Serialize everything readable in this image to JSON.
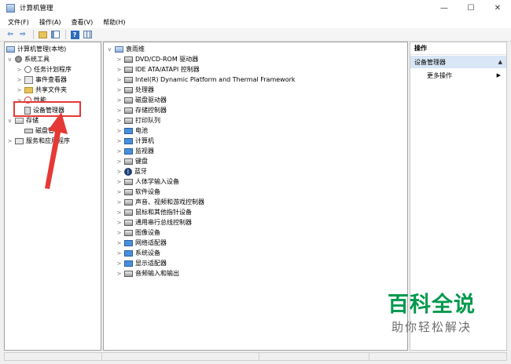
{
  "window": {
    "title": "计算机管理",
    "minimize_glyph": "—",
    "maximize_glyph": "☐",
    "close_glyph": "✕"
  },
  "menubar": [
    "文件(F)",
    "操作(A)",
    "查看(V)",
    "帮助(H)"
  ],
  "toolbar": {
    "back_glyph": "⇦",
    "forward_glyph": "⇨",
    "help_glyph": "?"
  },
  "left_tree": {
    "root": "计算机管理(本地)",
    "system_tools": "系统工具",
    "task_scheduler": "任务计划程序",
    "event_viewer": "事件查看器",
    "shared_folders": "共享文件夹",
    "performance": "性能",
    "device_manager": "设备管理器",
    "storage": "存储",
    "disk_management": "磁盘管理",
    "services_apps": "服务和应用程序"
  },
  "device_tree": {
    "root": "袁雨维",
    "categories": [
      {
        "label": "DVD/CD-ROM 驱动器",
        "icon": "dvd-icon"
      },
      {
        "label": "IDE ATA/ATAPI 控制器",
        "icon": "ide-controller-icon"
      },
      {
        "label": "Intel(R) Dynamic Platform and Thermal Framework",
        "icon": "intel-dptf-icon"
      },
      {
        "label": "处理器",
        "icon": "processor-icon"
      },
      {
        "label": "磁盘驱动器",
        "icon": "disk-drive-icon"
      },
      {
        "label": "存储控制器",
        "icon": "storage-controller-icon"
      },
      {
        "label": "打印队列",
        "icon": "printer-icon"
      },
      {
        "label": "电池",
        "icon": "battery-icon"
      },
      {
        "label": "计算机",
        "icon": "computer-icon"
      },
      {
        "label": "监视器",
        "icon": "monitor-icon"
      },
      {
        "label": "键盘",
        "icon": "keyboard-icon"
      },
      {
        "label": "蓝牙",
        "icon": "bluetooth-icon"
      },
      {
        "label": "人体学输入设备",
        "icon": "hid-icon"
      },
      {
        "label": "软件设备",
        "icon": "software-device-icon"
      },
      {
        "label": "声音、视频和游戏控制器",
        "icon": "audio-icon"
      },
      {
        "label": "鼠标和其他指针设备",
        "icon": "mouse-icon"
      },
      {
        "label": "通用串行总线控制器",
        "icon": "usb-icon"
      },
      {
        "label": "图像设备",
        "icon": "camera-icon"
      },
      {
        "label": "网络适配器",
        "icon": "network-adapter-icon"
      },
      {
        "label": "系统设备",
        "icon": "system-device-icon"
      },
      {
        "label": "显示适配器",
        "icon": "display-adapter-icon"
      },
      {
        "label": "音频输入和输出",
        "icon": "audio-io-icon"
      }
    ]
  },
  "actions": {
    "header": "操作",
    "section": "设备管理器",
    "more": "更多操作"
  },
  "watermark": {
    "title": "百科全说",
    "subtitle": "助你轻松解决"
  },
  "annotation_colors": {
    "highlight": "#e53935",
    "watermark_green": "#00994d"
  }
}
